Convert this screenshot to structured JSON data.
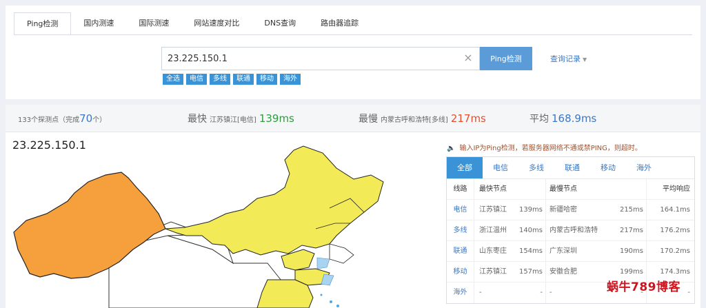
{
  "tabs": [
    {
      "label": "Ping检测",
      "active": true
    },
    {
      "label": "国内测速",
      "active": false
    },
    {
      "label": "国际测速",
      "active": false
    },
    {
      "label": "网站速度对比",
      "active": false
    },
    {
      "label": "DNS查询",
      "active": false
    },
    {
      "label": "路由器追踪",
      "active": false
    }
  ],
  "search": {
    "value": "23.225.150.1",
    "button_label": "Ping检测",
    "history_label": "查询记录"
  },
  "chips": [
    "全选",
    "电信",
    "多线",
    "联通",
    "移动",
    "海外"
  ],
  "stats": {
    "probe_prefix": "133个探测点（完成",
    "probe_done": "70",
    "probe_suffix": "个）",
    "fastest_label": "最快",
    "fastest_loc": "江苏镇江[电信]",
    "fastest_ms": "139ms",
    "slowest_label": "最慢",
    "slowest_loc": "内蒙古呼和浩特[多线]",
    "slowest_ms": "217ms",
    "avg_label": "平均",
    "avg_ms": "168.9ms"
  },
  "map": {
    "title": "23.225.150.1"
  },
  "notice": "输入IP为Ping检测，若服务器网络不通或禁PING，则超时。",
  "results": {
    "tabs": [
      "全部",
      "电信",
      "多线",
      "联通",
      "移动",
      "海外"
    ],
    "headers": [
      "线路",
      "最快节点",
      "最慢节点",
      "平均响应"
    ],
    "rows": [
      {
        "line": "电信",
        "fast_node": "江苏镇江",
        "fast_ms": "139ms",
        "slow_node": "新疆哈密",
        "slow_ms": "215ms",
        "avg": "164.1ms"
      },
      {
        "line": "多线",
        "fast_node": "浙江温州",
        "fast_ms": "140ms",
        "slow_node": "内蒙古呼和浩特",
        "slow_ms": "217ms",
        "avg": "176.2ms"
      },
      {
        "line": "联通",
        "fast_node": "山东枣庄",
        "fast_ms": "154ms",
        "slow_node": "广东深圳",
        "slow_ms": "190ms",
        "avg": "170.2ms"
      },
      {
        "line": "移动",
        "fast_node": "江苏镇江",
        "fast_ms": "157ms",
        "slow_node": "安徽合肥",
        "slow_ms": "199ms",
        "avg": "174.3ms"
      },
      {
        "line": "海外",
        "fast_node": "-",
        "fast_ms": "-",
        "slow_node": "-",
        "slow_ms": "-",
        "avg": "-"
      }
    ]
  },
  "watermark": "蜗牛789博客",
  "colors": {
    "accent": "#3a93d6",
    "fast": "#2e9b3e",
    "slow": "#e4502d",
    "avg": "#3a78c7",
    "map_orange": "#f5a03c",
    "map_yellow": "#f3ea58"
  }
}
